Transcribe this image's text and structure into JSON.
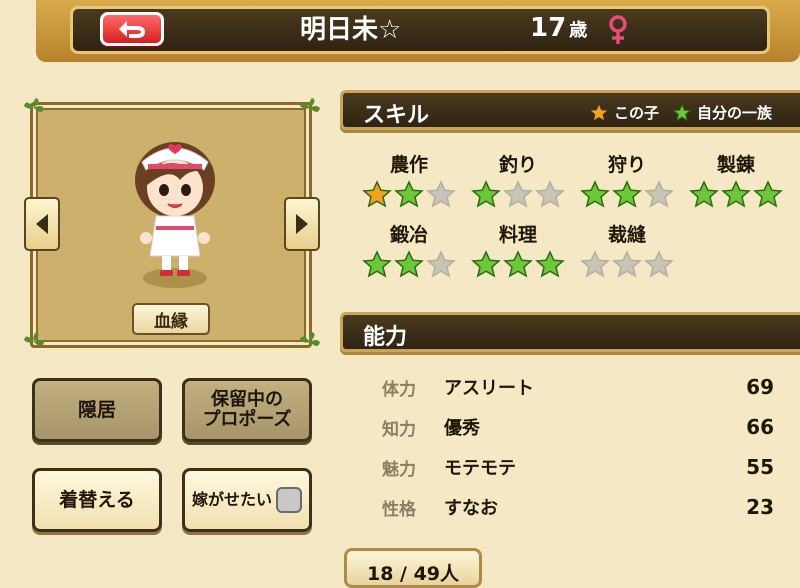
{
  "header": {
    "name": "明日未☆",
    "age": "17",
    "age_unit": "歳",
    "gender_icon": "female-icon",
    "back_icon": "back-arrow-icon"
  },
  "portrait": {
    "lineage_label": "血縁",
    "left_icon": "arrow-left-icon",
    "right_icon": "arrow-right-icon"
  },
  "actions": {
    "retire": "隠居",
    "pending_proposal_line1": "保留中の",
    "pending_proposal_line2": "プロポーズ",
    "change_clothes": "着替える",
    "want_to_marry_off": "嫁がせたい"
  },
  "skills_section": {
    "title": "スキル",
    "legend_self": "この子",
    "legend_family": "自分の一族",
    "skills": [
      {
        "name": "農作",
        "stars": [
          "orange",
          "green",
          "empty"
        ]
      },
      {
        "name": "釣り",
        "stars": [
          "green",
          "empty",
          "empty"
        ]
      },
      {
        "name": "狩り",
        "stars": [
          "green",
          "green",
          "empty"
        ]
      },
      {
        "name": "製錬",
        "stars": [
          "green",
          "green",
          "green"
        ]
      },
      {
        "name": "鍛冶",
        "stars": [
          "green",
          "green",
          "empty"
        ]
      },
      {
        "name": "料理",
        "stars": [
          "green",
          "green",
          "green"
        ]
      },
      {
        "name": "裁縫",
        "stars": [
          "empty",
          "empty",
          "empty"
        ]
      }
    ]
  },
  "abilities_section": {
    "title": "能力",
    "rows": [
      {
        "category": "体力",
        "desc": "アスリート",
        "value": "69"
      },
      {
        "category": "知力",
        "desc": "優秀",
        "value": "66"
      },
      {
        "category": "魅力",
        "desc": "モテモテ",
        "value": "55"
      },
      {
        "category": "性格",
        "desc": "すなお",
        "value": "23"
      }
    ]
  },
  "page_counter": "18 / 49人",
  "colors": {
    "star_orange": "#f2a21f",
    "star_green": "#6cc83a",
    "star_empty": "#c9c4b8",
    "header_dark": "#3a2d16",
    "back_red": "#e23030",
    "female_pink": "#e84a7a"
  }
}
